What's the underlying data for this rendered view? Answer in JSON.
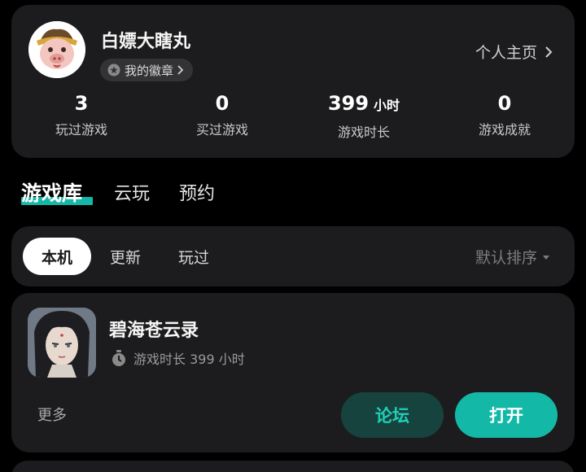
{
  "profile": {
    "username": "白嫖大瞎丸",
    "badge_label": "我的徽章",
    "homepage_label": "个人主页",
    "stats": [
      {
        "value": "3",
        "unit": "",
        "label": "玩过游戏"
      },
      {
        "value": "0",
        "unit": "",
        "label": "买过游戏"
      },
      {
        "value": "399",
        "unit": "小时",
        "label": "游戏时长"
      },
      {
        "value": "0",
        "unit": "",
        "label": "游戏成就"
      }
    ]
  },
  "tabs": [
    {
      "label": "游戏库",
      "active": true
    },
    {
      "label": "云玩",
      "active": false
    },
    {
      "label": "预约",
      "active": false
    }
  ],
  "filters": {
    "chips": [
      {
        "label": "本机",
        "active": true
      },
      {
        "label": "更新",
        "active": false
      },
      {
        "label": "玩过",
        "active": false
      }
    ],
    "sort_label": "默认排序"
  },
  "game": {
    "title": "碧海苍云录",
    "playtime_text": "游戏时长 399 小时",
    "more_label": "更多",
    "forum_label": "论坛",
    "open_label": "打开"
  },
  "colors": {
    "accent": "#14b8a6",
    "card_bg": "#1c1c1e",
    "page_bg": "#000000",
    "forum_bg": "#17433f"
  }
}
